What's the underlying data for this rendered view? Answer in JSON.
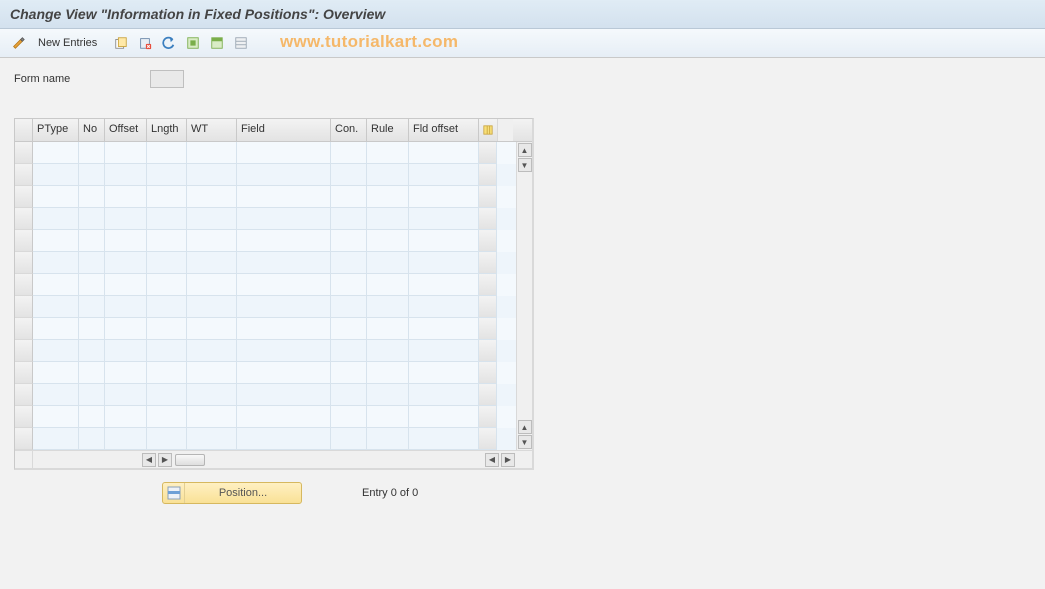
{
  "title": "Change View \"Information in Fixed Positions\": Overview",
  "toolbar": {
    "new_entries": "New Entries"
  },
  "watermark": "www.tutorialkart.com",
  "form": {
    "name_label": "Form name",
    "name_value": ""
  },
  "grid": {
    "columns": [
      "PType",
      "No",
      "Offset",
      "Lngth",
      "WT",
      "Field",
      "Con.",
      "Rule",
      "Fld offset"
    ],
    "rows": 14
  },
  "footer": {
    "position_label": "Position...",
    "entry_text": "Entry 0 of 0"
  }
}
